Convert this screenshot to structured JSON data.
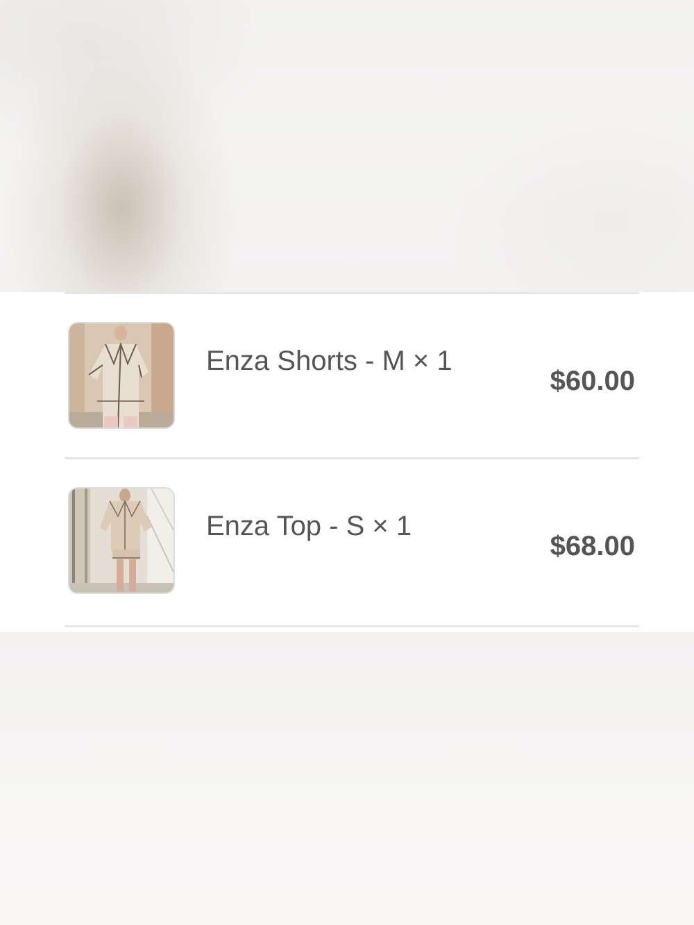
{
  "order_summary": {
    "items": [
      {
        "title": "Enza Shorts - M × 1",
        "price": "$60.00",
        "thumbnail": "product-photo-pajama-set"
      },
      {
        "title": "Enza Top - S × 1",
        "price": "$68.00",
        "thumbnail": "product-photo-pajama-set"
      }
    ]
  },
  "colors": {
    "text": "#555555",
    "divider": "#e6e6e6",
    "sheet_background": "#ffffff",
    "backdrop": "#f4f3f2"
  }
}
